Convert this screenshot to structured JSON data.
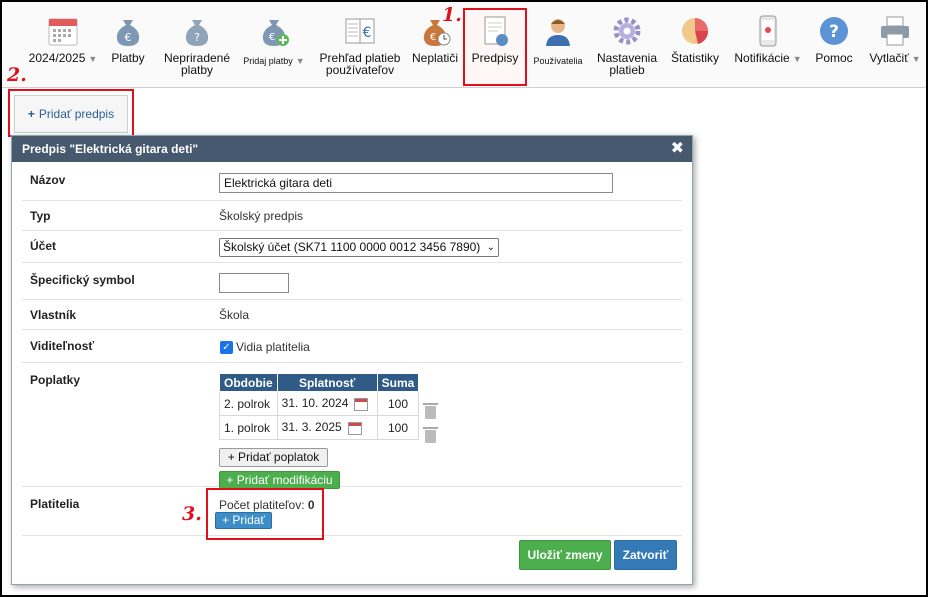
{
  "toolbar": {
    "items": [
      {
        "id": "year",
        "label": "2024/2025",
        "icon": "calendar-icon",
        "caret": true
      },
      {
        "id": "platby",
        "label": "Platby",
        "icon": "money-bag-euro-icon"
      },
      {
        "id": "nepriradene",
        "label": "Nepriradené platby",
        "icon": "money-bag-question-icon"
      },
      {
        "id": "pridaj",
        "label": "Pridaj platby",
        "icon": "money-bag-plus-icon",
        "caret": true
      },
      {
        "id": "prehlad",
        "label": "Prehľad platieb používateľov",
        "icon": "ledger-euro-icon"
      },
      {
        "id": "neplatici",
        "label": "Neplatiči",
        "icon": "money-bag-clock-icon"
      },
      {
        "id": "predpisy",
        "label": "Predpisy",
        "icon": "document-coin-icon",
        "active": true
      },
      {
        "id": "pouzivatelia",
        "label": "Používatelia",
        "icon": "user-icon"
      },
      {
        "id": "nastavenia",
        "label": "Nastavenia platieb",
        "icon": "gear-icon"
      },
      {
        "id": "statistiky",
        "label": "Štatistiky",
        "icon": "pie-chart-icon"
      },
      {
        "id": "notifikacie",
        "label": "Notifikácie",
        "icon": "phone-icon",
        "caret": true
      },
      {
        "id": "pomoc",
        "label": "Pomoc",
        "icon": "help-icon"
      },
      {
        "id": "vytlacit",
        "label": "Vytlačiť",
        "icon": "printer-icon",
        "caret": true
      }
    ]
  },
  "annotations": {
    "one": "1.",
    "two": "2.",
    "three": "3."
  },
  "add_button": "Pridať predpis",
  "dialog": {
    "title": "Predpis \"Elektrická gitara deti\"",
    "close": "✖",
    "fields": {
      "nazov": {
        "label": "Názov",
        "value": "Elektrická gitara deti"
      },
      "typ": {
        "label": "Typ",
        "value": "Školský predpis"
      },
      "ucet": {
        "label": "Účet",
        "value": "Školský účet (SK71 1100 0000 0012 3456 7890)"
      },
      "symbol": {
        "label": "Špecifický symbol",
        "value": ""
      },
      "vlastnik": {
        "label": "Vlastník",
        "value": "Škola"
      },
      "viditelnost": {
        "label": "Viditeľnosť",
        "value": "Vidia platitelia",
        "checked": true
      },
      "poplatky": {
        "label": "Poplatky"
      },
      "platitelia": {
        "label": "Platitelia"
      }
    },
    "fees": {
      "headers": [
        "Obdobie",
        "Splatnosť",
        "Suma"
      ],
      "rows": [
        {
          "period": "2. polrok",
          "due": "31. 10. 2024",
          "amount": "100"
        },
        {
          "period": "1. polrok",
          "due": "31. 3. 2025",
          "amount": "100"
        }
      ],
      "add_fee": "+ Pridať poplatok",
      "add_mod": "+ Pridať modifikáciu"
    },
    "payers": {
      "count_label": "Počet platiteľov:",
      "count": "0",
      "add": "+ Pridať"
    },
    "save": "Uložiť zmeny",
    "close_btn": "Zatvoriť"
  }
}
